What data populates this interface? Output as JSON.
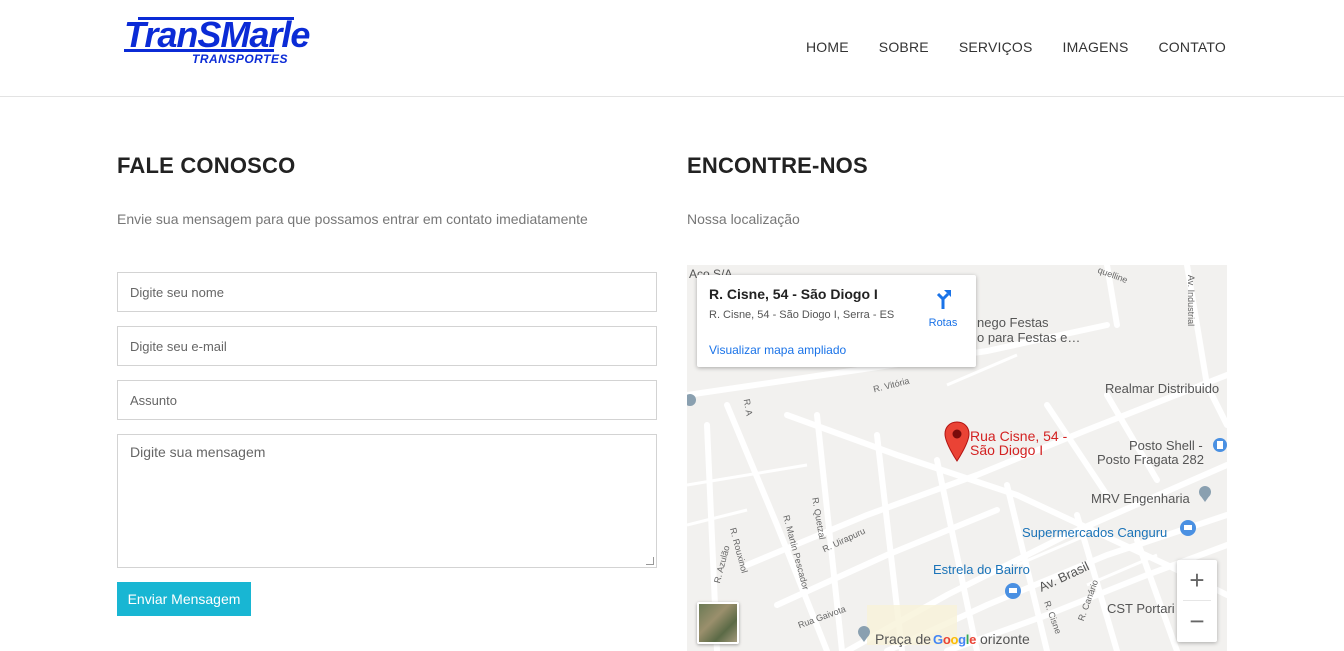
{
  "logo": {
    "main": "TranSMarle",
    "sub": "TRANSPORTES"
  },
  "nav": {
    "items": [
      "HOME",
      "SOBRE",
      "SERVIÇOS",
      "IMAGENS",
      "CONTATO"
    ]
  },
  "contact": {
    "title": "FALE CONOSCO",
    "subtitle": "Envie sua mensagem para que possamos entrar em contato imediatamente",
    "name_placeholder": "Digite seu nome",
    "email_placeholder": "Digite seu e-mail",
    "subject_placeholder": "Assunto",
    "message_placeholder": "Digite sua mensagem",
    "submit_label": "Enviar Mensagem"
  },
  "location": {
    "title": "ENCONTRE-NOS",
    "subtitle": "Nossa localização"
  },
  "map": {
    "card": {
      "title": "R. Cisne, 54 - São Diogo I",
      "address": "R. Cisne, 54 - São Diogo I, Serra - ES",
      "directions_label": "Rotas",
      "larger_map_link": "Visualizar mapa ampliado"
    },
    "pin_label_line1": "Rua Cisne, 54 -",
    "pin_label_line2": "São Diogo I",
    "places": {
      "realmar": "Realmar Distribuido",
      "shell": "Posto Shell -",
      "fragata": "Posto Fragata 282",
      "mrv": "MRV Engenharia",
      "canguru": "Supermercados Canguru",
      "estrela": "Estrela do Bairro",
      "cst": "CST Portari",
      "praca_a": "Praça de ",
      "praca_b": "orizonte",
      "festas_1": "nego Festas",
      "festas_2": "o para Festas e…",
      "aco": "Aço S/A"
    },
    "streets": {
      "vitoria": "R. Vitória",
      "ra": "R. A",
      "av_industrial": "Av. Industrial",
      "quel": "quelline",
      "quetzal": "R. Quetzal",
      "martin": "R. Martin Pescador",
      "uirapuru": "R. Uirapuru",
      "rouxinol": "R. Rouxinol",
      "azulao": "R. Azulão",
      "gaivota": "Rua Gaivota",
      "av_brasil": "Av. Brasil",
      "cisne": "R. Cisne",
      "canario": "R. Canário"
    },
    "google": [
      "G",
      "o",
      "o",
      "g",
      "l",
      "e"
    ],
    "zoom_in": "+",
    "zoom_out": "−"
  },
  "colors": {
    "brand": "#0b2bd6",
    "button": "#18b6d3",
    "link": "#1a73e8",
    "pin": "#d32222"
  }
}
